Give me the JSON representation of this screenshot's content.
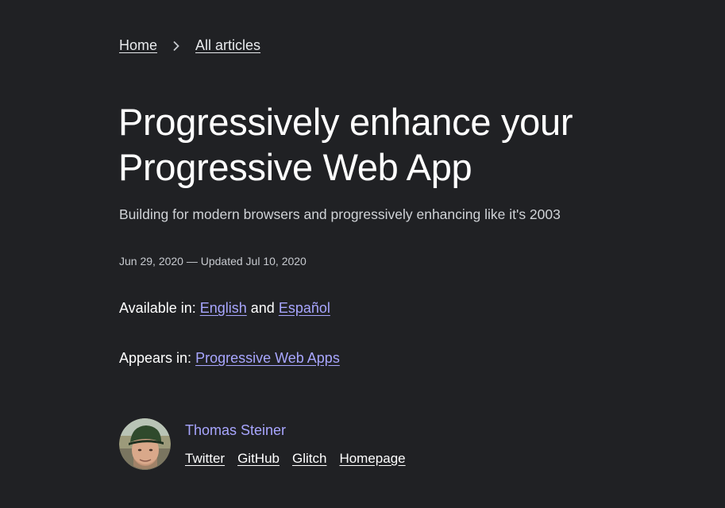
{
  "breadcrumb": {
    "home": "Home",
    "all_articles": "All articles"
  },
  "article": {
    "title": "Progressively enhance your Progressive Web App",
    "subtitle": "Building for modern browsers and progressively enhancing like it's 2003",
    "dates": "Jun 29, 2020 — Updated Jul 10, 2020"
  },
  "available": {
    "prefix": "Available in: ",
    "lang1": "English",
    "joiner": " and ",
    "lang2": "Español"
  },
  "appears": {
    "prefix": "Appears in: ",
    "collection": "Progressive Web Apps"
  },
  "author": {
    "name": "Thomas Steiner",
    "links": [
      "Twitter",
      "GitHub",
      "Glitch",
      "Homepage"
    ]
  },
  "colors": {
    "background": "#202124",
    "link_accent": "#a8a6ff",
    "text": "#ffffff"
  }
}
